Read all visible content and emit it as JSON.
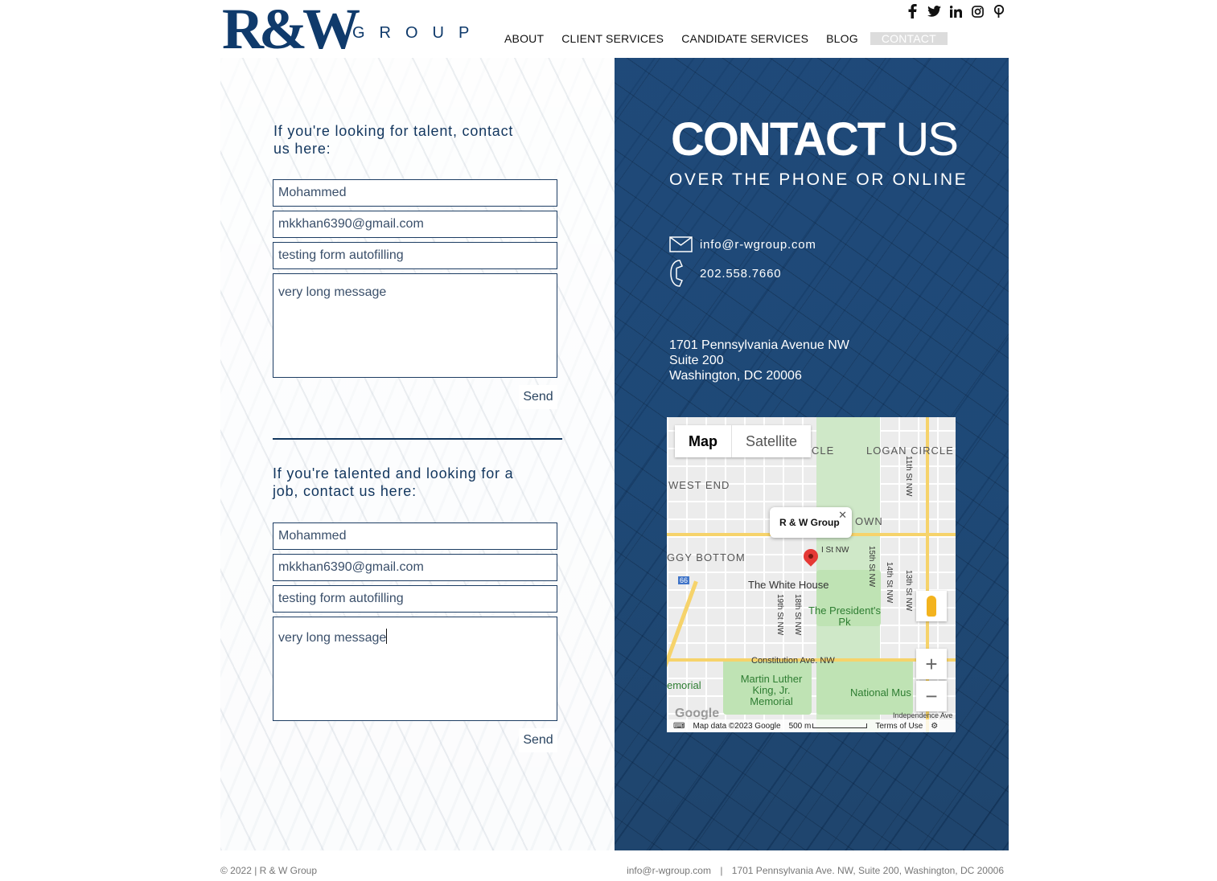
{
  "brand": {
    "logo_mark": "R&W",
    "logo_word": "GROUP",
    "primary_color": "#0f3a6b"
  },
  "social": [
    {
      "name": "facebook-icon",
      "glyph": "f"
    },
    {
      "name": "twitter-icon",
      "glyph": "🐦"
    },
    {
      "name": "linkedin-icon",
      "glyph": "in"
    },
    {
      "name": "instagram-icon",
      "glyph": "◎"
    },
    {
      "name": "pinterest-icon",
      "glyph": "℗"
    }
  ],
  "nav": {
    "items": [
      {
        "label": "ABOUT"
      },
      {
        "label": "CLIENT SERVICES"
      },
      {
        "label": "CANDIDATE SERVICES"
      },
      {
        "label": "BLOG"
      },
      {
        "label": "CONTACT"
      }
    ],
    "active": "CONTACT"
  },
  "talent_form": {
    "title": "If you're looking for talent, contact us here:",
    "name_value": "Mohammed",
    "email_value": "mkkhan6390@gmail.com",
    "subject_value": "testing form autofilling",
    "message_value": "very long message",
    "send_label": "Send"
  },
  "job_form": {
    "title": "If you're talented and looking for a job, contact us here:",
    "name_value": "Mohammed",
    "email_value": "mkkhan6390@gmail.com",
    "subject_value": "testing form autofilling",
    "message_value": "very long message",
    "send_label": "Send"
  },
  "contact": {
    "title_bold": "CONTACT",
    "title_light": "US",
    "subtitle": "OVER THE PHONE OR ONLINE",
    "email": "info@r-wgroup.com",
    "phone": "202.558.7660",
    "address_line1": "1701 Pennsylvania Avenue NW",
    "address_line2": "Suite 200",
    "address_line3": "Washington, DC 20006"
  },
  "map": {
    "tab_map": "Map",
    "tab_satellite": "Satellite",
    "popup_title": "R & W Group",
    "labels": {
      "logan_circle": "LOGAN CIRCLE",
      "cle": "CLE",
      "west_end": "WEST END",
      "own": "OWN",
      "foggy_bottom": "GGY BOTTOM",
      "white_house": "The White House",
      "presidents_park": "The President's Pk",
      "constitution_ave": "Constitution Ave. NW",
      "mlk_memorial": "Martin Luther King, Jr. Memorial",
      "memorial": "emorial",
      "national_mus": "National Mus",
      "independence_ave": "Independence Ave",
      "st_11th": "11th St NW",
      "st_15th": "15th St NW",
      "st_14th": "14th St NW",
      "st_13th": "13th St NW",
      "st_19th": "19th St NW",
      "st_18th": "18th St NW",
      "i_st": "I St NW",
      "route": "66"
    },
    "google": "Google",
    "attribution": "Map data ©2023 Google",
    "scale": "500 m",
    "terms": "Terms of Use",
    "zoom_in": "+",
    "zoom_out": "−"
  },
  "footer": {
    "copyright": "© 2022 | R & W Group",
    "email": "info@r-wgroup.com",
    "separator": "|",
    "address": "1701 Pennsylvania Ave. NW, Suite 200, Washington, DC 20006"
  }
}
